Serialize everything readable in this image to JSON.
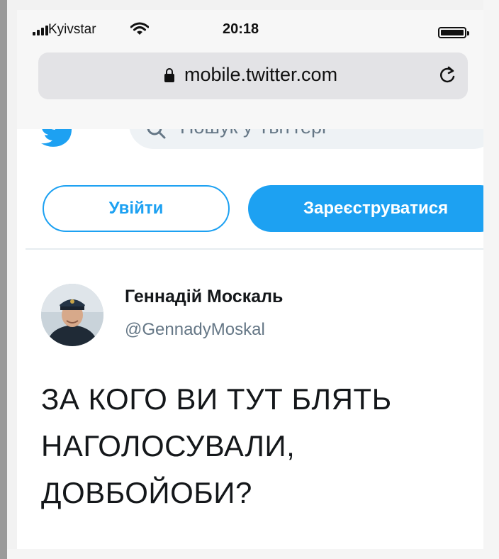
{
  "status_bar": {
    "carrier": "Kyivstar",
    "time": "20:18",
    "battery_level": 1.0
  },
  "browser": {
    "url": "mobile.twitter.com"
  },
  "twitter": {
    "search_placeholder": "Пошук у Твіттері",
    "login_label": "Увійти",
    "signup_label": "Зареєструватися"
  },
  "tweet": {
    "author_name": "Геннадій Москаль",
    "author_handle": "@GennadyMoskal",
    "text_lines": [
      "ЗА КОГО ВИ ТУТ БЛЯТЬ",
      "НАГОЛОСУВАЛИ,",
      "ДОВБОЙОБИ?"
    ]
  },
  "colors": {
    "twitter_blue": "#1da1f2",
    "text_dark": "#14171a",
    "text_gray": "#657786"
  },
  "icons": [
    "signal-icon",
    "wifi-icon",
    "battery-icon",
    "lock-icon",
    "reload-icon",
    "twitter-bird-icon",
    "search-icon"
  ]
}
